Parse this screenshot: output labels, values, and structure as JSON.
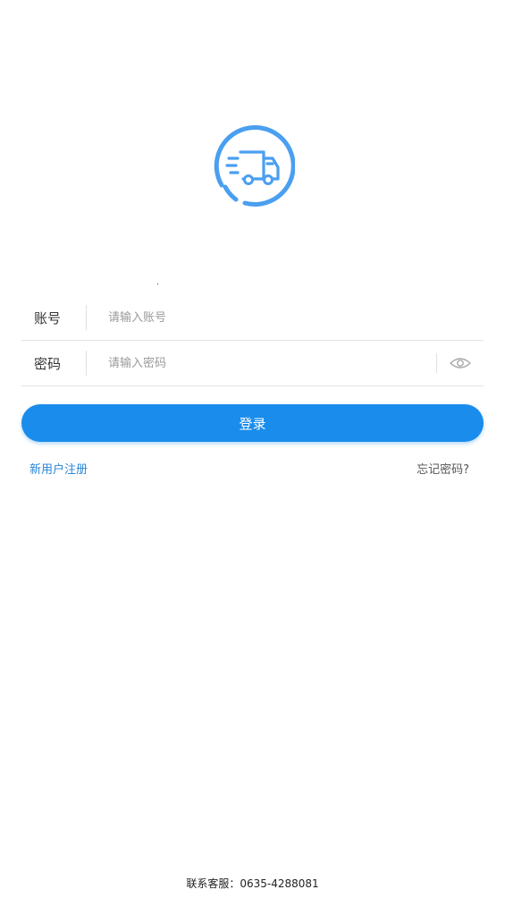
{
  "brand": {
    "accent_color": "#1a8cec",
    "logo_icon": "delivery-truck-icon"
  },
  "form": {
    "account": {
      "label": "账号",
      "placeholder": "请输入账号",
      "value": ""
    },
    "password": {
      "label": "密码",
      "placeholder": "请输入密码",
      "value": "",
      "visibility_icon": "eye-icon"
    }
  },
  "actions": {
    "login_label": "登录",
    "register_label": "新用户注册",
    "forgot_label": "忘记密码?"
  },
  "footer": {
    "contact": "联系客服：0635-4288081"
  }
}
